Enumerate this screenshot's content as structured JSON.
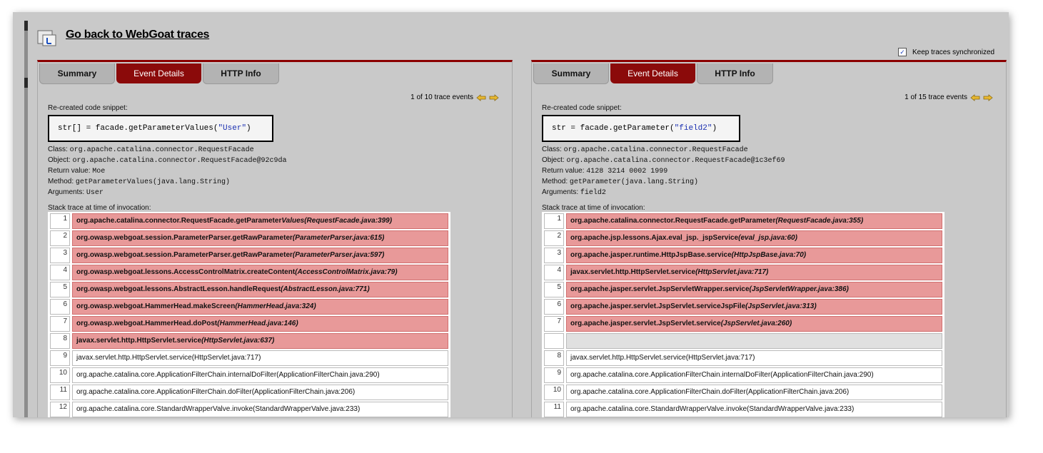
{
  "back_link": "Go back to WebGoat traces",
  "sync": {
    "label": "Keep traces synchronized",
    "check": "✓"
  },
  "left": {
    "tabs": [
      {
        "label": "Summary"
      },
      {
        "label": "Event Details"
      },
      {
        "label": "HTTP Info"
      }
    ],
    "counter": "1 of 10 trace events",
    "snippet_label": "Re-created code snippet:",
    "snippet_code": "str[] = facade.getParameterValues(",
    "snippet_arg": "\"User\"",
    "snippet_close": ")",
    "class_label": "Class:",
    "class_value": "org.apache.catalina.connector.RequestFacade",
    "object_label": "Object:",
    "object_value": "org.apache.catalina.connector.RequestFacade@92c9da",
    "return_label": "Return value:",
    "return_value": "Moe",
    "method_label": "Method:",
    "method_value": "getParameterValues(java.lang.String)",
    "args_label": "Arguments:",
    "args_value": "User",
    "stack_label": "Stack trace at time of invocation:",
    "frames": [
      {
        "num": "1",
        "cls": "org.apache.catalina.connector.RequestFacade.getParameter",
        "meth": "Values(RequestFacade.java:399)"
      },
      {
        "num": "2",
        "cls": "org.owasp.webgoat.session.ParameterParser.getRawParameter",
        "meth": "(ParameterParser.java:615)"
      },
      {
        "num": "3",
        "cls": "org.owasp.webgoat.session.ParameterParser.getRawParameter",
        "meth": "(ParameterParser.java:597)"
      },
      {
        "num": "4",
        "cls": "org.owasp.webgoat.lessons.AccessControlMatrix.createContent",
        "meth": "(AccessControlMatrix.java:79)"
      },
      {
        "num": "5",
        "cls": "org.owasp.webgoat.lessons.AbstractLesson.handleRequest",
        "meth": "(AbstractLesson.java:771)"
      },
      {
        "num": "6",
        "cls": "org.owasp.webgoat.HammerHead.makeScreen",
        "meth": "(HammerHead.java:324)"
      },
      {
        "num": "7",
        "cls": "org.owasp.webgoat.HammerHead.doPost",
        "meth": "(HammerHead.java:146)"
      },
      {
        "num": "8",
        "cls": "javax.servlet.http.HttpServlet.service",
        "meth": "(HttpServlet.java:637)"
      },
      {
        "num": "9",
        "text": "javax.servlet.http.HttpServlet.service(HttpServlet.java:717)"
      },
      {
        "num": "10",
        "text": "org.apache.catalina.core.ApplicationFilterChain.internalDoFilter(ApplicationFilterChain.java:290)"
      },
      {
        "num": "11",
        "text": "org.apache.catalina.core.ApplicationFilterChain.doFilter(ApplicationFilterChain.java:206)"
      },
      {
        "num": "12",
        "text": "org.apache.catalina.core.StandardWrapperValve.invoke(StandardWrapperValve.java:233)"
      }
    ]
  },
  "right": {
    "tabs": [
      {
        "label": "Summary"
      },
      {
        "label": "Event Details"
      },
      {
        "label": "HTTP Info"
      }
    ],
    "counter": "1 of 15 trace events",
    "snippet_label": "Re-created code snippet:",
    "snippet_code": "str = facade.getParameter(",
    "snippet_arg": "\"field2\"",
    "snippet_close": ")",
    "class_label": "Class:",
    "class_value": "org.apache.catalina.connector.RequestFacade",
    "object_label": "Object:",
    "object_value": "org.apache.catalina.connector.RequestFacade@1c3ef69",
    "return_label": "Return value:",
    "return_value": "4128 3214 0002 1999",
    "method_label": "Method:",
    "method_value": "getParameter(java.lang.String)",
    "args_label": "Arguments:",
    "args_value": "field2",
    "stack_label": "Stack trace at time of invocation:",
    "frames": [
      {
        "num": "1",
        "cls": "org.apache.catalina.connector.RequestFacade.getParameter",
        "meth": "(RequestFacade.java:355)"
      },
      {
        "num": "2",
        "cls": "org.apache.jsp.lessons.Ajax.eval_jsp._jspService",
        "meth": "(eval_jsp.java:60)"
      },
      {
        "num": "3",
        "cls": "org.apache.jasper.runtime.HttpJspBase.service",
        "meth": "(HttpJspBase.java:70)"
      },
      {
        "num": "4",
        "cls": "javax.servlet.http.HttpServlet.service",
        "meth": "(HttpServlet.java:717)"
      },
      {
        "num": "5",
        "cls": "org.apache.jasper.servlet.JspServletWrapper.service",
        "meth": "(JspServletWrapper.java:386)"
      },
      {
        "num": "6",
        "cls": "org.apache.jasper.servlet.JspServlet.serviceJspFile",
        "meth": "(JspServlet.java:313)"
      },
      {
        "num": "7",
        "cls": "org.apache.jasper.servlet.JspServlet.service",
        "meth": "(JspServlet.java:260)"
      },
      {
        "num": "",
        "gap": true
      },
      {
        "num": "8",
        "text": "javax.servlet.http.HttpServlet.service(HttpServlet.java:717)"
      },
      {
        "num": "9",
        "text": "org.apache.catalina.core.ApplicationFilterChain.internalDoFilter(ApplicationFilterChain.java:290)"
      },
      {
        "num": "10",
        "text": "org.apache.catalina.core.ApplicationFilterChain.doFilter(ApplicationFilterChain.java:206)"
      },
      {
        "num": "11",
        "text": "org.apache.catalina.core.StandardWrapperValve.invoke(StandardWrapperValve.java:233)"
      }
    ]
  }
}
